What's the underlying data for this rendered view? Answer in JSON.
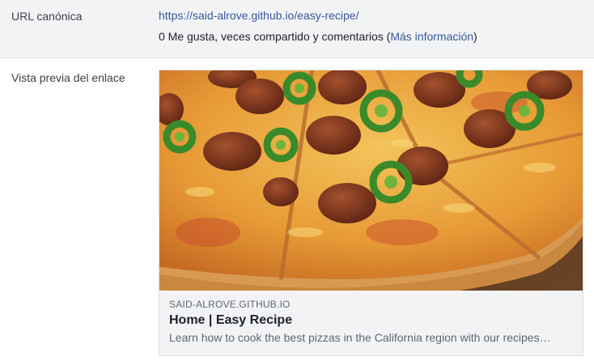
{
  "canonical": {
    "label": "URL canónica",
    "url": "https://said-alrove.github.io/easy-recipe/",
    "stats_text": "0 Me gusta, veces compartido y comentarios (",
    "more_info_link": "Más información",
    "stats_close": ")"
  },
  "preview": {
    "label": "Vista previa del enlace",
    "domain": "SAID-ALROVE.GITHUB.IO",
    "title": "Home | Easy Recipe",
    "description": "Learn how to cook the best pizzas in the California region with our recipes…",
    "image_subject": "pepperoni-jalapeno-pizza"
  },
  "colors": {
    "link": "#365899",
    "top_row_bg": "#f2f3f5",
    "card_bg": "#f2f3f5"
  }
}
